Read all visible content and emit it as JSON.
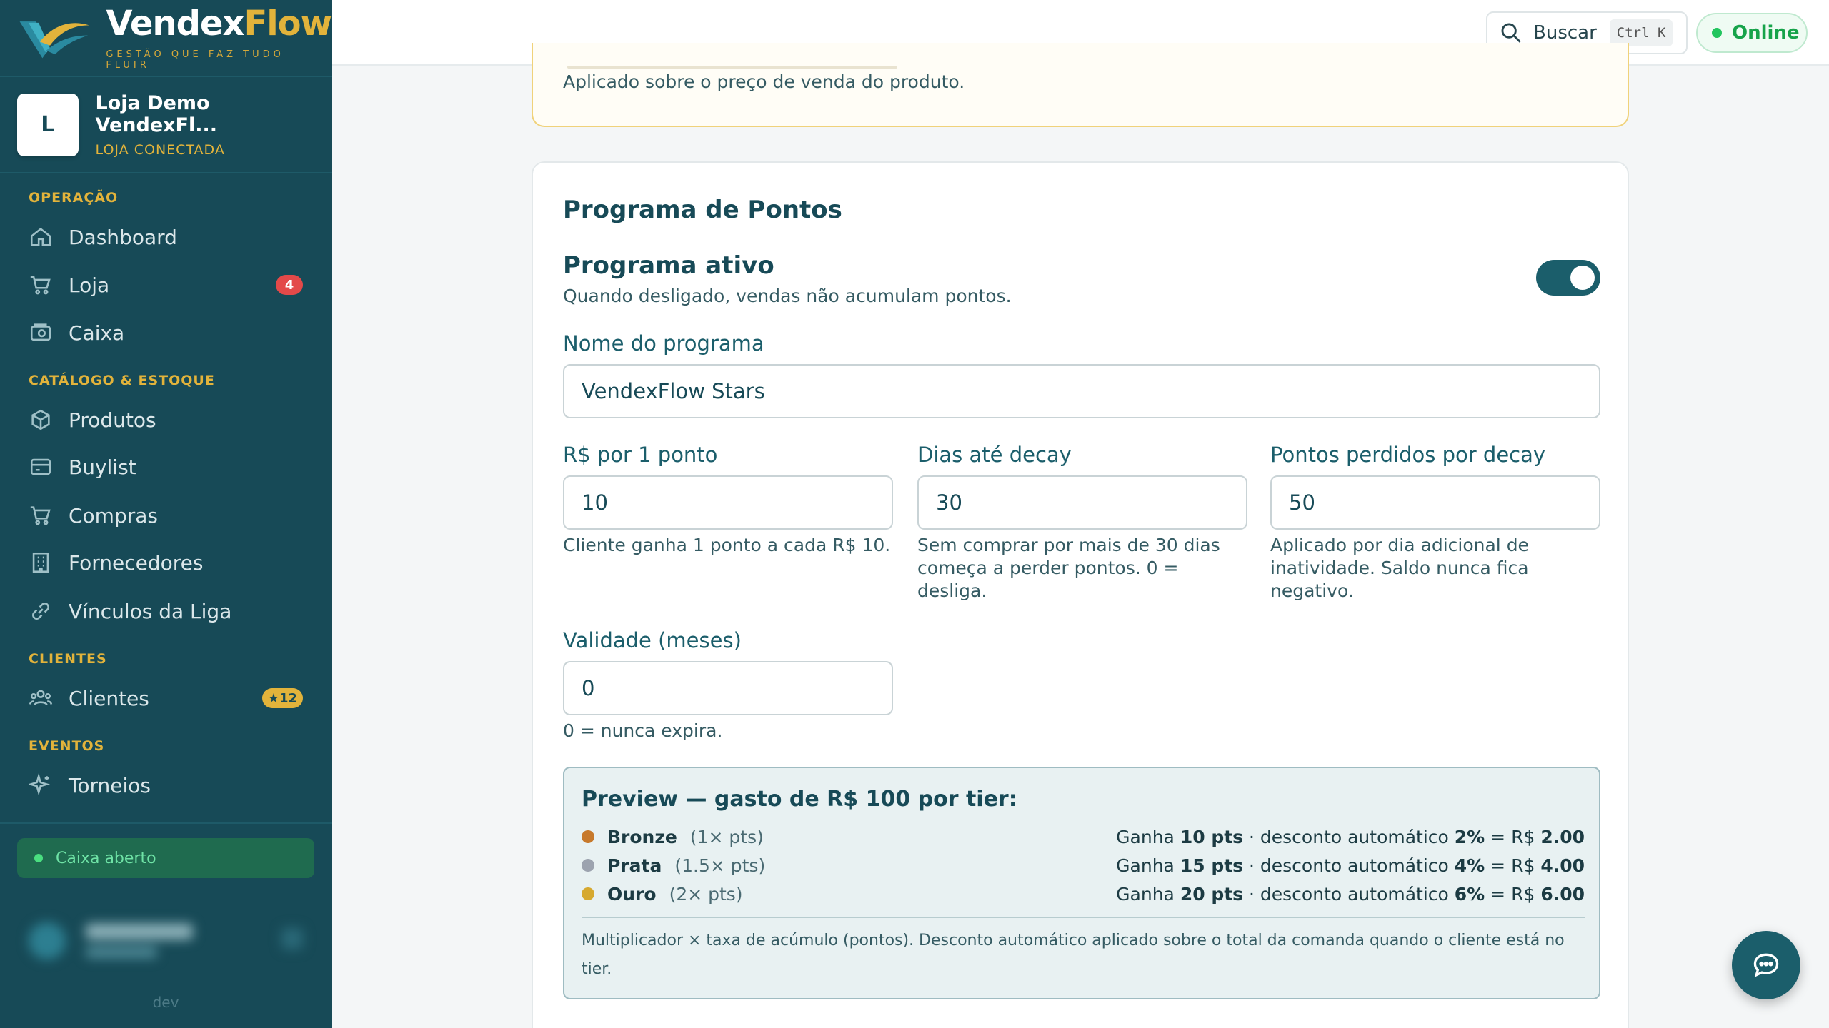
{
  "brand": {
    "name_part1": "Vendex",
    "name_part2": "Flow",
    "tagline": "GESTÃO QUE FAZ TUDO FLUIR"
  },
  "store": {
    "initial": "L",
    "name": "Loja Demo VendexFl...",
    "status": "LOJA CONECTADA"
  },
  "sidebar": {
    "sections": [
      {
        "title": "OPERAÇÃO"
      },
      {
        "title": "CATÁLOGO & ESTOQUE"
      },
      {
        "title": "CLIENTES"
      },
      {
        "title": "EVENTOS"
      }
    ],
    "items": [
      {
        "label": "Dashboard",
        "icon": "home-icon"
      },
      {
        "label": "Loja",
        "icon": "cart-icon",
        "badge": "4"
      },
      {
        "label": "Caixa",
        "icon": "cash-register-icon"
      },
      {
        "label": "Produtos",
        "icon": "box-icon"
      },
      {
        "label": "Buylist",
        "icon": "card-icon"
      },
      {
        "label": "Compras",
        "icon": "cart-icon"
      },
      {
        "label": "Fornecedores",
        "icon": "building-icon"
      },
      {
        "label": "Vínculos da Liga",
        "icon": "link-icon"
      },
      {
        "label": "Clientes",
        "icon": "users-icon",
        "badge": "★12"
      },
      {
        "label": "Torneios",
        "icon": "sparkles-icon"
      }
    ],
    "cash_status": "Caixa aberto",
    "env": "dev"
  },
  "topbar": {
    "search_label": "Buscar",
    "search_shortcut": "Ctrl K",
    "status": "Online"
  },
  "discount_card": {
    "hint": "Aplicado sobre o preço de venda do produto."
  },
  "points": {
    "title": "Programa de Pontos",
    "active_title": "Programa ativo",
    "active_desc": "Quando desligado, vendas não acumulam pontos.",
    "active": true,
    "name_label": "Nome do programa",
    "name_value": "VendexFlow Stars",
    "rate_label": "R$ por 1 ponto",
    "rate_value": "10",
    "rate_hint": "Cliente ganha 1 ponto a cada R$ 10.",
    "decay_days_label": "Dias até decay",
    "decay_days_value": "30",
    "decay_days_hint": "Sem comprar por mais de 30 dias começa a perder pontos. 0 = desliga.",
    "decay_points_label": "Pontos perdidos por decay",
    "decay_points_value": "50",
    "decay_points_hint": "Aplicado por dia adicional de inatividade. Saldo nunca fica negativo.",
    "validity_label": "Validade (meses)",
    "validity_value": "0",
    "validity_hint": "0 = nunca expira."
  },
  "preview": {
    "title": "Preview — gasto de R$ 100 por tier:",
    "tiers": [
      {
        "name": "Bronze",
        "mult": "(1× pts)",
        "color": "#c7792b",
        "pts": "10 pts",
        "disc": "2%",
        "total": "2.00"
      },
      {
        "name": "Prata",
        "mult": "(1.5× pts)",
        "color": "#9ca3af",
        "pts": "15 pts",
        "disc": "4%",
        "total": "4.00"
      },
      {
        "name": "Ouro",
        "mult": "(2× pts)",
        "color": "#d6a92f",
        "pts": "20 pts",
        "disc": "6%",
        "total": "6.00"
      }
    ],
    "earn_prefix": "Ganha",
    "disc_prefix": " · desconto automático ",
    "equals": " = R$ ",
    "footnote": "Multiplicador × taxa de acúmulo (pontos). Desconto automático aplicado sobre o total da comanda quando o cliente está no tier."
  },
  "colors": {
    "sidebar": "#174a57",
    "accent": "#e2b33b",
    "primary": "#1b5e6b",
    "online": "#16a34a",
    "danger": "#e34949"
  }
}
